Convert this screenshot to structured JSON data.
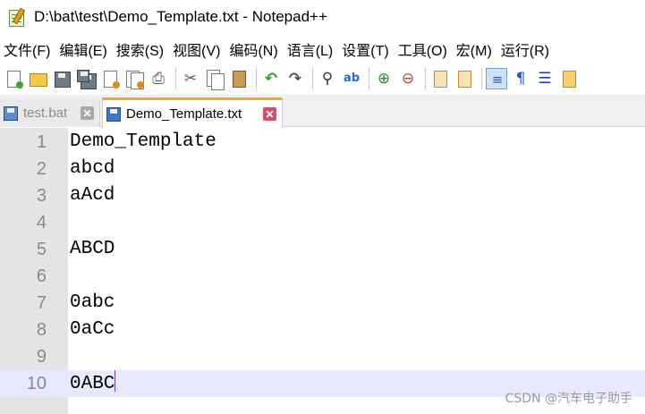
{
  "window": {
    "title": "D:\\bat\\test\\Demo_Template.txt - Notepad++"
  },
  "menu": [
    "文件(F)",
    "编辑(E)",
    "搜索(S)",
    "视图(V)",
    "编码(N)",
    "语言(L)",
    "设置(T)",
    "工具(O)",
    "宏(M)",
    "运行(R)"
  ],
  "toolbar_icons": [
    "new-file-icon",
    "open-file-icon",
    "save-icon",
    "save-all-icon",
    "close-icon",
    "close-all-icon",
    "print-icon",
    "cut-icon",
    "copy-icon",
    "paste-icon",
    "undo-icon",
    "redo-icon",
    "find-icon",
    "replace-icon",
    "zoom-in-icon",
    "zoom-out-icon",
    "sync-vertical-icon",
    "sync-horizontal-icon",
    "word-wrap-icon",
    "show-all-chars-icon",
    "indent-guide-icon",
    "doc-map-icon"
  ],
  "tabs": [
    {
      "label": "test.bat",
      "active": false
    },
    {
      "label": "Demo_Template.txt",
      "active": true
    }
  ],
  "editor": {
    "lines": [
      {
        "num": "1",
        "text": "Demo_Template"
      },
      {
        "num": "2",
        "text": "abcd"
      },
      {
        "num": "3",
        "text": "aAcd"
      },
      {
        "num": "4",
        "text": ""
      },
      {
        "num": "5",
        "text": "ABCD"
      },
      {
        "num": "6",
        "text": ""
      },
      {
        "num": "7",
        "text": "0abc"
      },
      {
        "num": "8",
        "text": "0aCc"
      },
      {
        "num": "9",
        "text": ""
      },
      {
        "num": "10",
        "text": "0ABC"
      }
    ],
    "current_line": 10
  },
  "watermark": "CSDN @汽车电子助手",
  "colors": {
    "active_tab_accent": "#f5a623",
    "current_line_bg": "#e8e8ff",
    "gutter_bg": "#e4e4e4",
    "tab_close_active": "#d2526e"
  }
}
